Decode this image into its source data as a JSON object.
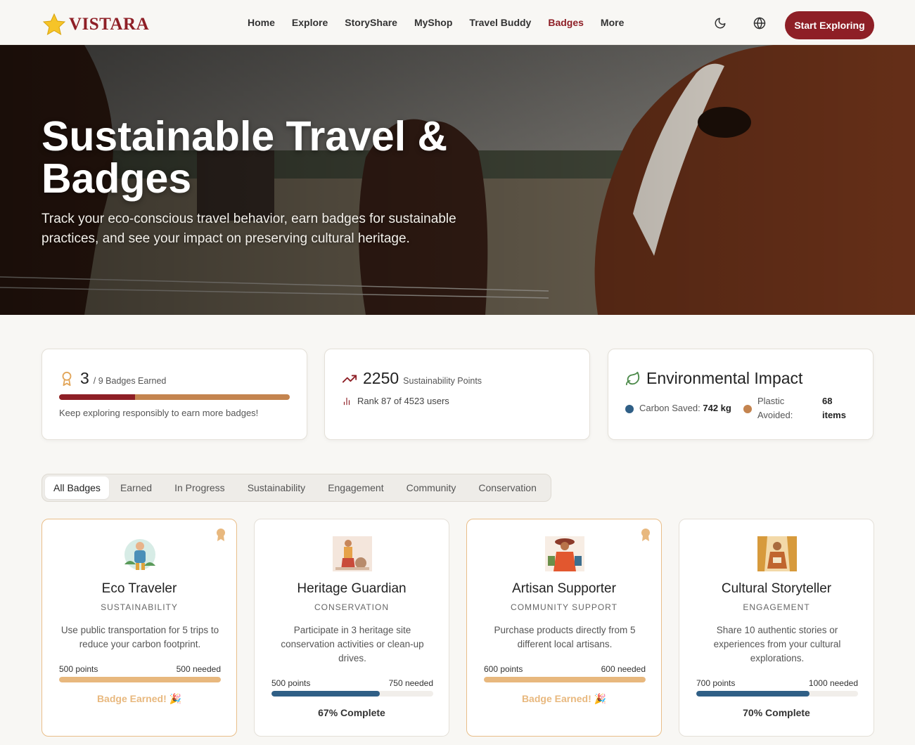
{
  "nav": {
    "logo_text": "VISTARA",
    "links": [
      "Home",
      "Explore",
      "StoryShare",
      "MyShop",
      "Travel Buddy",
      "Badges",
      "More"
    ],
    "active_link": "Badges",
    "cta": "Start Exploring",
    "icons": [
      "moon-icon",
      "globe-icon"
    ]
  },
  "hero": {
    "title": "Sustainable Travel & Badges",
    "subtitle": "Track your eco-conscious travel behavior, earn badges for sustainable practices, and see your impact on preserving cultural heritage."
  },
  "stats": {
    "badges": {
      "earned": "3",
      "total_label": "/ 9 Badges Earned",
      "progress": 0.33,
      "note": "Keep exploring responsibly to earn more badges!"
    },
    "points": {
      "value": "2250",
      "label": "Sustainability Points",
      "rank": "Rank 87 of 4523 users"
    },
    "impact": {
      "title": "Environmental Impact",
      "carbon_label": "Carbon Saved:",
      "carbon_value": "742 kg",
      "plastic_label_1": "Plastic",
      "plastic_label_2": "Avoided:",
      "plastic_value_1": "68",
      "plastic_value_2": "items"
    }
  },
  "tabs": [
    "All Badges",
    "Earned",
    "In Progress",
    "Sustainability",
    "Engagement",
    "Community",
    "Conservation"
  ],
  "active_tab": "All Badges",
  "badges": [
    {
      "name": "Eco Traveler",
      "category": "SUSTAINABILITY",
      "description": "Use public transportation for 5 trips to reduce your carbon footprint.",
      "points": "500 points",
      "needed": "500 needed",
      "progress": 1.0,
      "earned": true,
      "status": "Badge Earned! 🎉"
    },
    {
      "name": "Heritage Guardian",
      "category": "CONSERVATION",
      "description": "Participate in 3 heritage site conservation activities or clean-up drives.",
      "points": "500 points",
      "needed": "750 needed",
      "progress": 0.67,
      "earned": false,
      "status": "67% Complete"
    },
    {
      "name": "Artisan Supporter",
      "category": "COMMUNITY SUPPORT",
      "description": "Purchase products directly from 5 different local artisans.",
      "points": "600 points",
      "needed": "600 needed",
      "progress": 1.0,
      "earned": true,
      "status": "Badge Earned! 🎉"
    },
    {
      "name": "Cultural Storyteller",
      "category": "ENGAGEMENT",
      "description": "Share 10 authentic stories or experiences from your cultural explorations.",
      "points": "700 points",
      "needed": "1000 needed",
      "progress": 0.7,
      "earned": false,
      "status": "70% Complete"
    }
  ],
  "colors": {
    "brand": "#8e1f26",
    "accent": "#c4844f",
    "earned": "#e8b87e",
    "progress_blue": "#2f5f86",
    "eco_green": "#4c8a4a"
  }
}
